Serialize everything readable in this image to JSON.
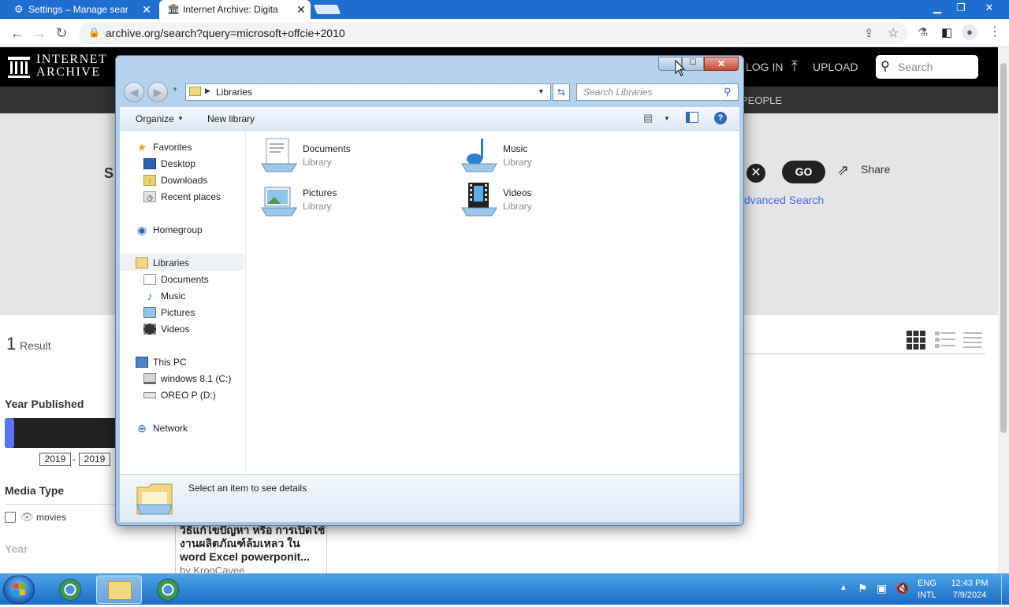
{
  "browser": {
    "tabs": [
      {
        "title": "Settings – Manage sear",
        "close": "✕"
      },
      {
        "title": "Internet Archive: Digita",
        "close": "✕"
      }
    ],
    "url": "archive.org/search?query=microsoft+offcie+2010"
  },
  "archive": {
    "logo_line1": "INTERNET",
    "logo_line2": "ARCHIVE",
    "login": "LOG IN",
    "upload": "UPLOAD",
    "search_placeholder": "Search",
    "people": "PEOPLE",
    "go": "GO",
    "share": "Share",
    "advanced": "dvanced Search",
    "s_letter": "S",
    "result_count": "1",
    "result_label": "Result",
    "year_published": "Year Published",
    "year_from": "2019",
    "year_dash": "-",
    "year_to": "2019",
    "media_type": "Media Type",
    "media_movies": "movies",
    "year_label": "Year",
    "item_title": "วิธีแก้ไขปัญหา หรือ การเปิดใช้งานผลิตภัณฑ์ล้มเหลว ใน word Excel powerponit...",
    "item_title_l1": "วิธีแก้ไขปัญหา หรือ การเปิดใช้",
    "item_title_l2": "งานผลิตภัณฑ์ล้มเหลว ใน",
    "item_title_l3": "word Excel powerponit...",
    "item_by": "by KrooCavee"
  },
  "explorer": {
    "address": "Libraries",
    "search_placeholder": "Search Libraries",
    "organize": "Organize",
    "new_library": "New library",
    "nav": {
      "favorites": "Favorites",
      "desktop": "Desktop",
      "downloads": "Downloads",
      "recent": "Recent places",
      "homegroup": "Homegroup",
      "libraries": "Libraries",
      "documents": "Documents",
      "music": "Music",
      "pictures": "Pictures",
      "videos": "Videos",
      "thispc": "This PC",
      "drive_c": "windows 8.1 (C:)",
      "drive_d": "OREO P (D:)",
      "network": "Network"
    },
    "libraries": [
      {
        "name": "Documents",
        "type": "Library"
      },
      {
        "name": "Music",
        "type": "Library"
      },
      {
        "name": "Pictures",
        "type": "Library"
      },
      {
        "name": "Videos",
        "type": "Library"
      }
    ],
    "details": "Select an item to see details"
  },
  "taskbar": {
    "lang1": "ENG",
    "lang2": "INTL",
    "time": "12:43 PM",
    "date": "7/9/2024"
  }
}
